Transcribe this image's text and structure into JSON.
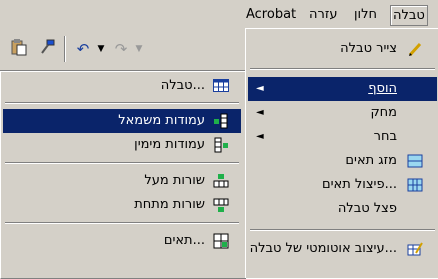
{
  "menubar": {
    "items": [
      "טבלה",
      "חלון",
      "עזרה",
      "Acrobat"
    ]
  },
  "toolbar": {
    "icons": [
      "paste-icon",
      "format-painter-icon",
      "undo-icon",
      "redo-icon"
    ]
  },
  "table_menu": {
    "items": [
      {
        "label": "צייר טבלה",
        "icon": "pencil-icon"
      },
      {
        "label": "הוסף",
        "submenu": true
      },
      {
        "label": "מחק",
        "submenu": true
      },
      {
        "label": "בחר",
        "submenu": true
      },
      {
        "label": "מזג תאים",
        "icon": "merge-cells-icon"
      },
      {
        "label": "פיצול תאים...",
        "icon": "split-cells-icon"
      },
      {
        "label": "פצל טבלה"
      },
      {
        "label": "עיצוב אוטומטי של טבלה...",
        "icon": "autoformat-icon"
      }
    ]
  },
  "insert_submenu": {
    "items": [
      {
        "label": "טבלה...",
        "icon": "table-icon"
      },
      {
        "label": "עמודות משמאל",
        "icon": "columns-left-icon"
      },
      {
        "label": "עמודות מימין",
        "icon": "columns-right-icon"
      },
      {
        "label": "שורות מעל",
        "icon": "rows-above-icon"
      },
      {
        "label": "שורות מתחת",
        "icon": "rows-below-icon"
      },
      {
        "label": "תאים...",
        "icon": "cells-icon"
      }
    ]
  },
  "colors": {
    "selection": "#0a246a",
    "face": "#d4d0c8"
  }
}
